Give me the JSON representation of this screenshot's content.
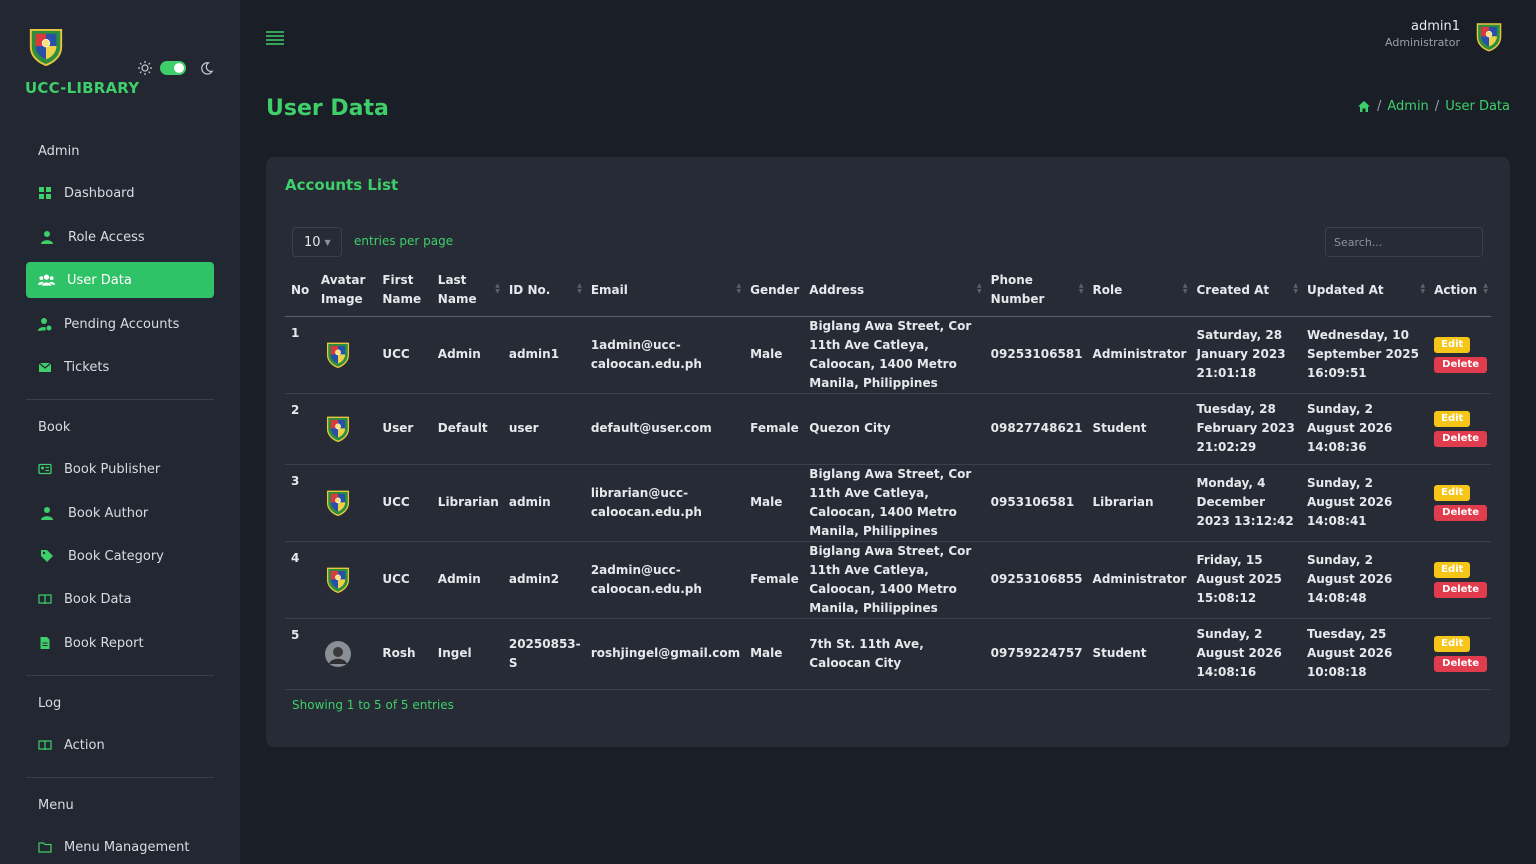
{
  "brand": {
    "name": "UCC-LIBRARY"
  },
  "sidebar": {
    "sections": [
      {
        "title": "Admin",
        "items": [
          {
            "label": "Dashboard",
            "icon": "dashboard-icon"
          },
          {
            "label": "Role Access",
            "icon": "user-icon"
          },
          {
            "label": "User Data",
            "icon": "users-icon",
            "active": true
          },
          {
            "label": "Pending Accounts",
            "icon": "user-clock-icon"
          },
          {
            "label": "Tickets",
            "icon": "envelope-icon"
          }
        ]
      },
      {
        "title": "Book",
        "items": [
          {
            "label": "Book Publisher",
            "icon": "id-card-icon"
          },
          {
            "label": "Book Author",
            "icon": "user-icon"
          },
          {
            "label": "Book Category",
            "icon": "tag-icon"
          },
          {
            "label": "Book Data",
            "icon": "book-open-icon"
          },
          {
            "label": "Book Report",
            "icon": "file-icon"
          }
        ]
      },
      {
        "title": "Log",
        "items": [
          {
            "label": "Action",
            "icon": "book-open-icon"
          }
        ]
      },
      {
        "title": "Menu",
        "items": [
          {
            "label": "Menu Management",
            "icon": "folder-icon"
          }
        ]
      }
    ]
  },
  "header": {
    "user_name": "admin1",
    "user_role": "Administrator"
  },
  "page": {
    "title": "User Data",
    "breadcrumb": [
      "Admin",
      "User Data"
    ]
  },
  "card": {
    "title": "Accounts List",
    "per_page": "10",
    "per_page_label": "entries per page",
    "search_placeholder": "Search...",
    "showing": "Showing 1 to 5 of 5 entries"
  },
  "table": {
    "columns": [
      "No",
      "Avatar Image",
      "First Name",
      "Last Name",
      "ID No.",
      "Email",
      "Gender",
      "Address",
      "Phone Number",
      "Role",
      "Created At",
      "Updated At",
      "Action"
    ],
    "edit_label": "Edit",
    "delete_label": "Delete",
    "rows": [
      {
        "no": "1",
        "avatar": "crest",
        "first": "UCC",
        "last": "Admin",
        "id": "admin1",
        "email": "1admin@ucc-caloocan.edu.ph",
        "gender": "Male",
        "address": "Biglang Awa Street, Cor 11th Ave Catleya, Caloocan, 1400 Metro Manila, Philippines",
        "phone": "09253106581",
        "role": "Administrator",
        "created": "Saturday, 28 January 2023 21:01:18",
        "updated": "Wednesday, 10 September 2025 16:09:51"
      },
      {
        "no": "2",
        "avatar": "crest",
        "first": "User",
        "last": "Default",
        "id": "user",
        "email": "default@user.com",
        "gender": "Female",
        "address": "Quezon City",
        "phone": "09827748621",
        "role": "Student",
        "created": "Tuesday, 28 February 2023 21:02:29",
        "updated": "Sunday, 2 August 2026 14:08:36"
      },
      {
        "no": "3",
        "avatar": "crest",
        "first": "UCC",
        "last": "Librarian",
        "id": "admin",
        "email": "librarian@ucc-caloocan.edu.ph",
        "gender": "Male",
        "address": "Biglang Awa Street, Cor 11th Ave Catleya, Caloocan, 1400 Metro Manila, Philippines",
        "phone": "0953106581",
        "role": "Librarian",
        "created": "Monday, 4 December 2023 13:12:42",
        "updated": "Sunday, 2 August 2026 14:08:41"
      },
      {
        "no": "4",
        "avatar": "crest",
        "first": "UCC",
        "last": "Admin",
        "id": "admin2",
        "email": "2admin@ucc-caloocan.edu.ph",
        "gender": "Female",
        "address": "Biglang Awa Street, Cor 11th Ave Catleya, Caloocan, 1400 Metro Manila, Philippines",
        "phone": "09253106855",
        "role": "Administrator",
        "created": "Friday, 15 August 2025 15:08:12",
        "updated": "Sunday, 2 August 2026 14:08:48"
      },
      {
        "no": "5",
        "avatar": "photo",
        "first": "Rosh",
        "last": "Ingel",
        "id": "20250853-S",
        "email": "roshjingel@gmail.com",
        "gender": "Male",
        "address": "7th St. 11th Ave, Caloocan City",
        "phone": "09759224757",
        "role": "Student",
        "created": "Sunday, 2 August 2026 14:08:16",
        "updated": "Tuesday, 25 August 2026 10:08:18"
      }
    ]
  },
  "colors": {
    "accent": "#3ecf6a",
    "sidebar_bg": "#222731",
    "page_bg": "#1a1e26",
    "card_bg": "#262b35",
    "edit": "#f5c518",
    "delete": "#e03c4e"
  }
}
